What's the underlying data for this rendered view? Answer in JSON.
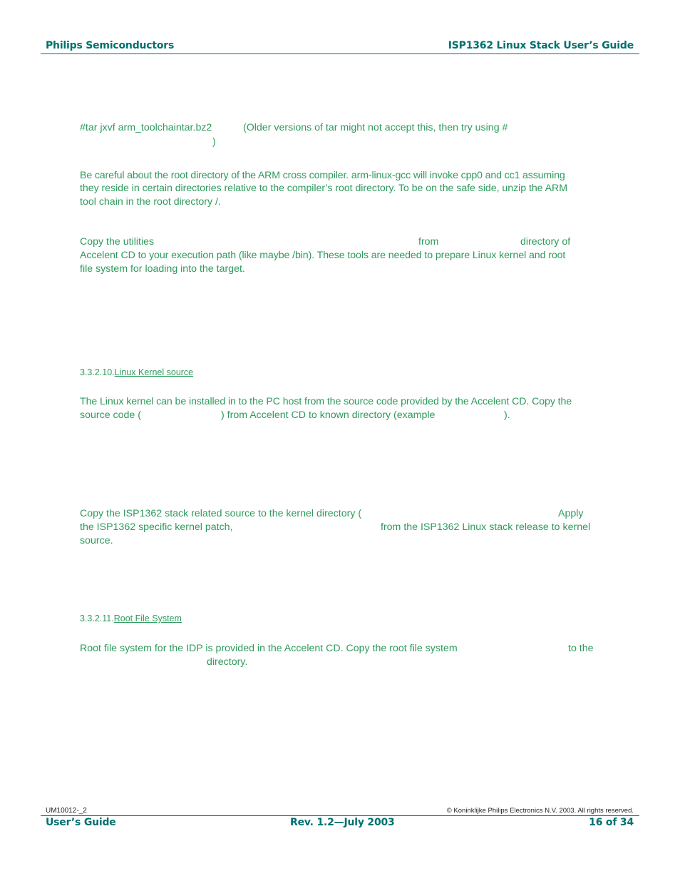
{
  "header": {
    "left": "Philips Semiconductors",
    "right": "ISP1362 Linux Stack User’s Guide"
  },
  "content": {
    "tar_cmd": "#tar jxvf arm_toolchaintar.bz2",
    "tar_note": "(Older versions of tar might not accept this, then try using #",
    "tar_note_close": ")",
    "careful_para": [
      "Be careful about the root directory of the ARM cross compiler. arm-linux-gcc will invoke cpp0 and cc1 assuming",
      "they reside in certain directories relative to the compiler’s root directory. To be on the safe side, unzip the ARM",
      "tool chain in the root directory /."
    ],
    "copy_utils": {
      "part1": "Copy the utilities",
      "part2": "from",
      "part3": "directory of",
      "line2": "Accelent CD to your execution path (like maybe /bin). These tools are needed to prepare Linux kernel and root",
      "line3": "file system for loading into the target."
    },
    "section_kernel": {
      "number": "3.3.2.10.",
      "title": "Linux Kernel source"
    },
    "kernel_para": {
      "line1": "The Linux kernel can be installed in to the PC host from the source code provided by the Accelent CD. Copy the",
      "line2a": "source code (",
      "line2b": ") from Accelent CD to known directory (example",
      "line2c": ")."
    },
    "isp_para": {
      "line1a": "Copy the ISP1362 stack related source to the kernel directory (",
      "line1b": "Apply",
      "line2a": "the ISP1362 specific kernel patch,",
      "line2b": "from the ISP1362 Linux stack release to kernel",
      "line3": "source."
    },
    "section_rootfs": {
      "number": "3.3.2.11.",
      "title": "Root File System"
    },
    "rootfs_para": {
      "line1a": "Root file system for the IDP is provided in the Accelent CD. Copy the root file system",
      "line1b": "to the",
      "line2": "directory."
    }
  },
  "footer": {
    "doc_id": "UM10012-_2",
    "copyright": "© Koninklijke Philips Electronics N.V. 2003. All rights reserved.",
    "left": "User’s Guide",
    "center": "Rev. 1.2—July 2003",
    "right": "16 of 34"
  }
}
